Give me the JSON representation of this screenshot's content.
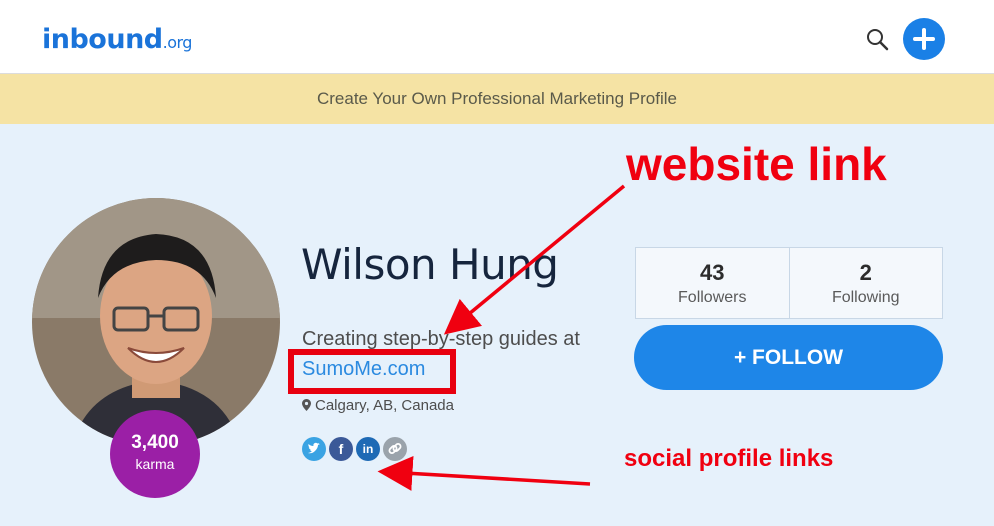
{
  "header": {
    "logo_main": "inbound",
    "logo_suffix": ".org",
    "icons": [
      "search-icon",
      "plus-icon"
    ]
  },
  "banner": {
    "text": "Create Your Own Professional Marketing Profile"
  },
  "profile": {
    "name": "Wilson Hung",
    "tagline": "Creating step-by-step guides at",
    "website": "SumoMe.com",
    "location": "Calgary, AB, Canada",
    "karma_value": "3,400",
    "karma_label": "karma",
    "social_icons": [
      "twitter-icon",
      "facebook-icon",
      "linkedin-icon",
      "link-icon"
    ]
  },
  "stats": [
    {
      "value": "43",
      "label": "Followers"
    },
    {
      "value": "2",
      "label": "Following"
    }
  ],
  "follow_button": "+ FOLLOW",
  "annotations": {
    "website": "website link",
    "social": "social profile links"
  },
  "colors": {
    "brand": "#1a73d9",
    "banner": "#f5e3a4",
    "karma": "#9b1fa6",
    "annotation": "#f00010",
    "follow": "#1e86e8"
  }
}
